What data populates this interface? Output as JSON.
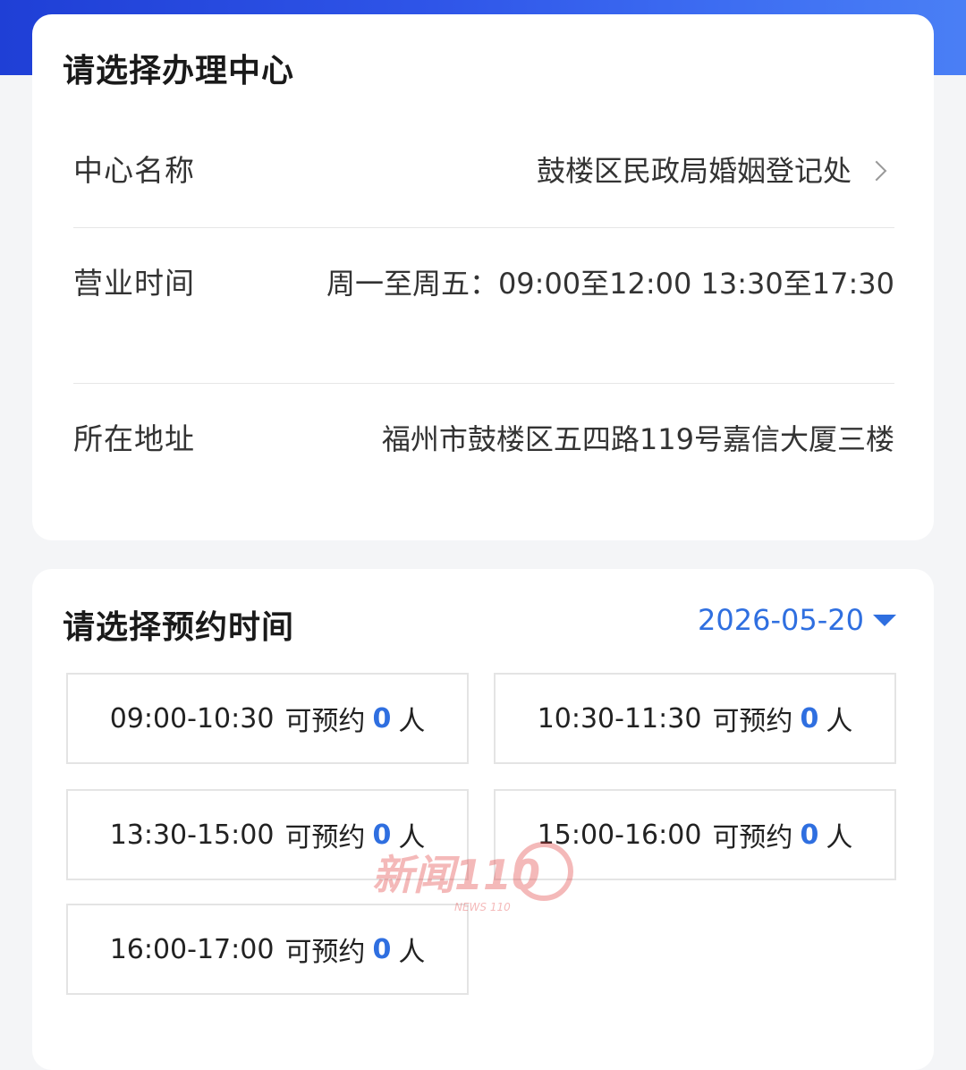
{
  "center_card": {
    "title": "请选择办理中心",
    "rows": [
      {
        "label": "中心名称",
        "value": "鼓楼区民政局婚姻登记处"
      },
      {
        "label": "营业时间",
        "value": "周一至周五：09:00至12:00 13:30至17:30"
      },
      {
        "label": "所在地址",
        "value": "福州市鼓楼区五四路119号嘉信大厦三楼"
      }
    ]
  },
  "time_card": {
    "title": "请选择预约时间",
    "date": "2026-05-20",
    "slots": [
      {
        "time": "09:00-10:30",
        "label": "可预约",
        "count": "0",
        "unit": "人"
      },
      {
        "time": "10:30-11:30",
        "label": "可预约",
        "count": "0",
        "unit": "人"
      },
      {
        "time": "13:30-15:00",
        "label": "可预约",
        "count": "0",
        "unit": "人"
      },
      {
        "time": "15:00-16:00",
        "label": "可预约",
        "count": "0",
        "unit": "人"
      },
      {
        "time": "16:00-17:00",
        "label": "可预约",
        "count": "0",
        "unit": "人"
      }
    ]
  },
  "watermark": {
    "text": "新闻110",
    "subtext": "NEWS 110"
  },
  "colors": {
    "accent": "#2f6fe0",
    "banner": "#2f55e8"
  }
}
